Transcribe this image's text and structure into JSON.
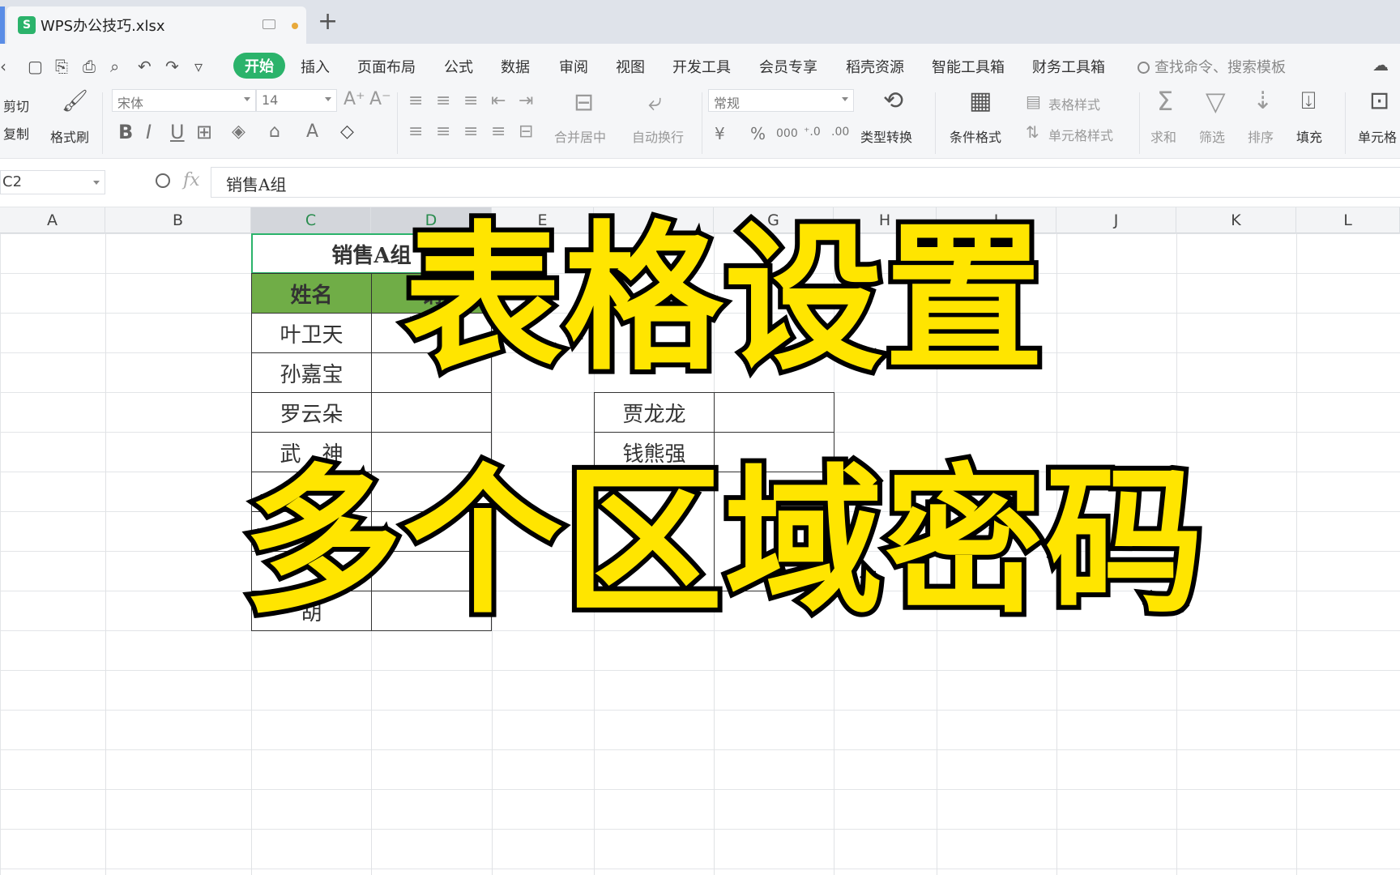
{
  "window": {
    "file_tab": "WPS办公技巧.xlsx",
    "app_logo_letter": "S",
    "new_tab_symbol": "+"
  },
  "menu": {
    "items": [
      "开始",
      "插入",
      "页面布局",
      "公式",
      "数据",
      "审阅",
      "视图",
      "开发工具",
      "会员专享",
      "稻壳资源",
      "智能工具箱",
      "财务工具箱"
    ],
    "search_placeholder": "查找命令、搜索模板"
  },
  "ribbon": {
    "cut": "剪切",
    "copy": "复制",
    "format_painter": "格式刷",
    "font_name": "宋体",
    "font_size": "14",
    "merge_center": "合并居中",
    "wrap_text": "自动换行",
    "number_format": "常规",
    "type_convert": "类型转换",
    "conditional_format": "条件格式",
    "table_style": "表格样式",
    "cell_style": "单元格样式",
    "sum": "求和",
    "filter": "筛选",
    "sort": "排序",
    "fill": "填充",
    "cell": "单元格",
    "currency_symbol": "¥",
    "percent_symbol": "%",
    "thousands_symbol": "000"
  },
  "formula_bar": {
    "name_box": "C2",
    "fx_label": "fx",
    "content": "销售A组"
  },
  "columns": [
    "A",
    "B",
    "C",
    "D",
    "E",
    "F",
    "G",
    "H",
    "I",
    "J",
    "K",
    "L"
  ],
  "sheet": {
    "group_a_title": "销售A组",
    "header_name": "姓名",
    "header_sales_partial": "销",
    "group_a_names": [
      "叶卫天",
      "孙嘉宝",
      "罗云朵",
      "武　神",
      "严",
      "",
      "",
      "胡"
    ],
    "group_b_names": [
      "贾龙龙",
      "钱熊强"
    ]
  },
  "overlay": {
    "line1": "表格设置",
    "line2": "多个区域密码"
  },
  "colors": {
    "brand_green": "#2bb36b",
    "header_green": "#70ad47",
    "overlay_yellow": "#ffe500"
  }
}
